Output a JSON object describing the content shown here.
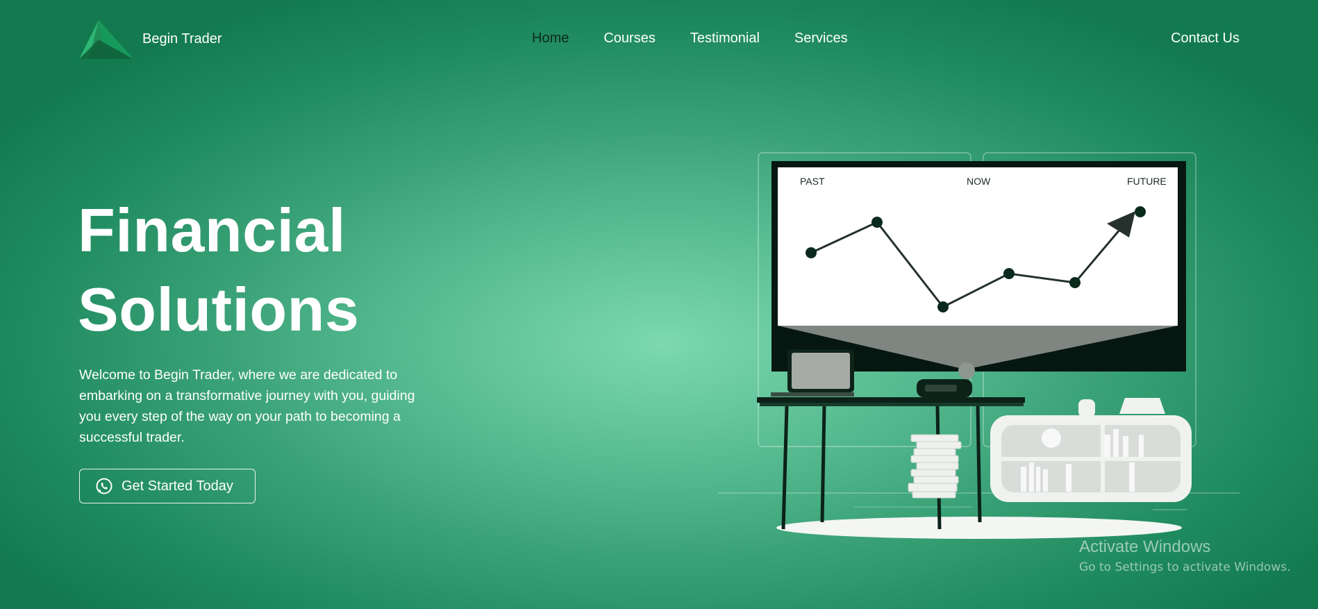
{
  "brand": {
    "name": "Begin Trader",
    "logo_icon": "triangle-logo-icon"
  },
  "nav": {
    "items": [
      {
        "label": "Home",
        "active": true
      },
      {
        "label": "Courses"
      },
      {
        "label": "Testimonial"
      },
      {
        "label": "Services"
      }
    ],
    "contact_label": "Contact Us"
  },
  "hero": {
    "title_line1": "Financial",
    "title_line2": "Solutions",
    "description": "Welcome to Begin Trader, where we are dedicated to embarking on a transformative journey with you, guiding you every step of the way on your path to becoming a successful trader.",
    "cta_label": "Get Started Today",
    "cta_icon": "whatsapp-icon"
  },
  "illustration": {
    "labels": {
      "past": "PAST",
      "now": "NOW",
      "future": "FUTURE"
    }
  },
  "watermark": {
    "line1": "Activate Windows",
    "line2": "Go to Settings to activate Windows."
  },
  "colors": {
    "accent": "#1f8b5e",
    "dark": "#0f2a1f",
    "white": "#ffffff"
  }
}
